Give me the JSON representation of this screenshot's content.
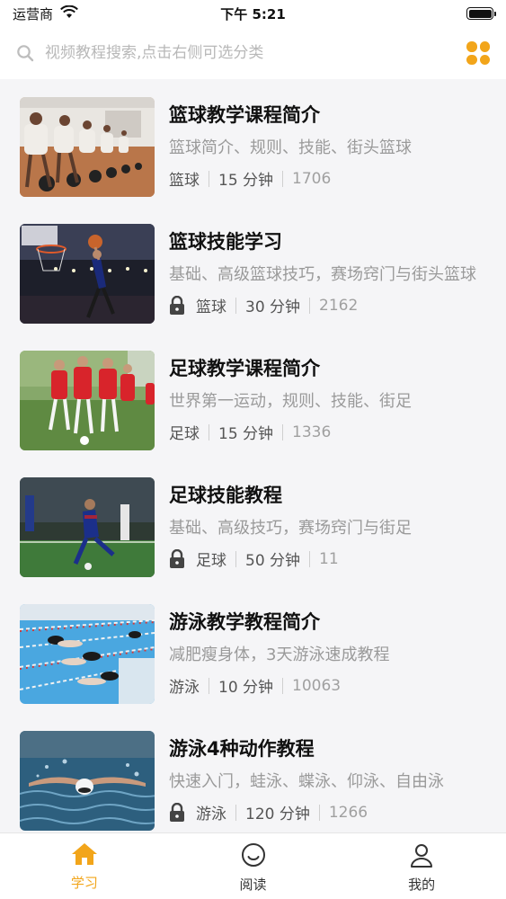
{
  "status": {
    "carrier": "运营商",
    "time": "下午 5:21"
  },
  "search": {
    "placeholder": "视频教程搜索,点击右侧可选分类"
  },
  "courses": [
    {
      "title": "篮球教学课程简介",
      "desc": "篮球简介、规则、技能、街头篮球",
      "category": "篮球",
      "duration": "15 分钟",
      "count": "1706",
      "locked": false,
      "thumb": "basketball-training"
    },
    {
      "title": "篮球技能学习",
      "desc": "基础、高级篮球技巧，赛场窍门与街头篮球",
      "category": "篮球",
      "duration": "30 分钟",
      "count": "2162",
      "locked": true,
      "thumb": "basketball-dunk"
    },
    {
      "title": "足球教学课程简介",
      "desc": "世界第一运动，规则、技能、街足",
      "category": "足球",
      "duration": "15 分钟",
      "count": "1336",
      "locked": false,
      "thumb": "soccer-kids"
    },
    {
      "title": "足球技能教程",
      "desc": "基础、高级技巧，赛场窍门与街足",
      "category": "足球",
      "duration": "50 分钟",
      "count": "11",
      "locked": true,
      "thumb": "soccer-player"
    },
    {
      "title": "游泳教学教程简介",
      "desc": "减肥瘦身体，3天游泳速成教程",
      "category": "游泳",
      "duration": "10 分钟",
      "count": "10063",
      "locked": false,
      "thumb": "swimming-pool"
    },
    {
      "title": "游泳4种动作教程",
      "desc": "快速入门，蛙泳、蝶泳、仰泳、自由泳",
      "category": "游泳",
      "duration": "120 分钟",
      "count": "1266",
      "locked": true,
      "thumb": "swimmer-butterfly"
    }
  ],
  "tabs": [
    {
      "label": "学习",
      "icon": "home-icon",
      "active": true
    },
    {
      "label": "阅读",
      "icon": "smile-icon",
      "active": false
    },
    {
      "label": "我的",
      "icon": "user-icon",
      "active": false
    }
  ],
  "colors": {
    "accent": "#f2a51a"
  }
}
